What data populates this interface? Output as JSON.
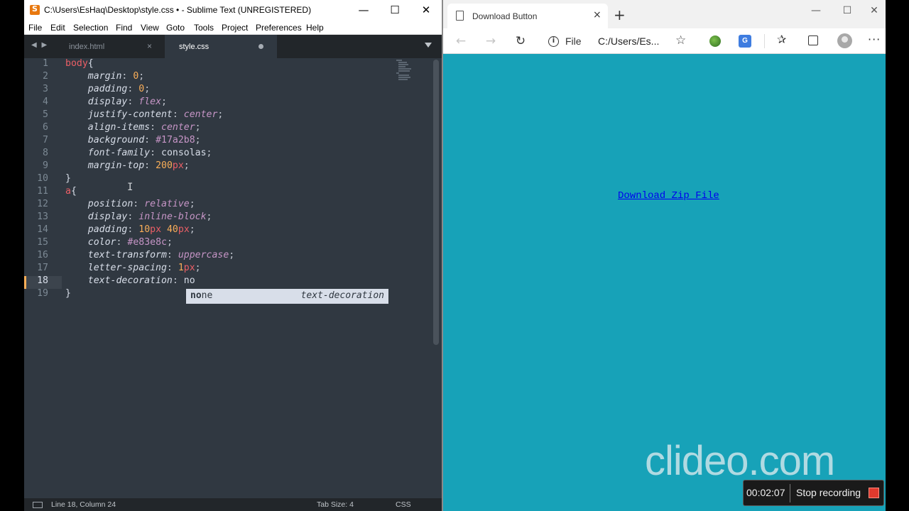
{
  "sublime": {
    "title": "C:\\Users\\EsHaq\\Desktop\\style.css • - Sublime Text (UNREGISTERED)",
    "menu": [
      "File",
      "Edit",
      "Selection",
      "Find",
      "View",
      "Goto",
      "Tools",
      "Project",
      "Preferences",
      "Help"
    ],
    "tab_nav": "◀ ▶",
    "tabs": [
      {
        "label": "index.html",
        "close": "×",
        "active": false
      },
      {
        "label": "style.css",
        "active": true,
        "modified": true
      }
    ],
    "line_numbers": [
      "1",
      "2",
      "3",
      "4",
      "5",
      "6",
      "7",
      "8",
      "9",
      "10",
      "11",
      "12",
      "13",
      "14",
      "15",
      "16",
      "17",
      "18",
      "19"
    ],
    "code": {
      "l1_sel": "body",
      "l1_brace": "{",
      "l2_prop": "margin",
      "l2_num": "0",
      "l3_prop": "padding",
      "l3_num": "0",
      "l4_prop": "display",
      "l4_val": "flex",
      "l5_prop": "justify-content",
      "l5_val": "center",
      "l6_prop": "align-items",
      "l6_val": "center",
      "l7_prop": "background",
      "l7_val": "#17a2b8",
      "l8_prop": "font-family",
      "l8_val": "consolas",
      "l9_prop": "margin-top",
      "l9_num": "200",
      "l9_unit": "px",
      "l10": "}",
      "l11_sel": "a",
      "l11_brace": "{",
      "l12_prop": "position",
      "l12_val": "relative",
      "l13_prop": "display",
      "l13_val": "inline-block",
      "l14_prop": "padding",
      "l14_num1": "10",
      "l14_unit1": "px",
      "l14_num2": "40",
      "l14_unit2": "px",
      "l15_prop": "color",
      "l15_val": "#e83e8c",
      "l16_prop": "text-transform",
      "l16_val": "uppercase",
      "l17_prop": "letter-spacing",
      "l17_num": "1",
      "l17_unit": "px",
      "l18_prop": "text-decoration",
      "l18_val": "no",
      "l19": "}",
      "colon": ":",
      "semi": ";"
    },
    "autocomplete": {
      "match": "no",
      "rest": "ne",
      "hint": "text-decoration"
    },
    "status": {
      "position": "Line 18, Column 24",
      "tab_size": "Tab Size: 4",
      "syntax": "CSS"
    }
  },
  "browser": {
    "tab_title": "Download Button",
    "tab_close": "×",
    "new_tab": "+",
    "address_label": "File",
    "url": "C:/Users/Es...",
    "translate_badge": "G",
    "link_text": "Download Zip File",
    "page_background": "#17a2b8"
  },
  "overlay": {
    "watermark": "clideo.com",
    "rec_time": "00:02:07",
    "rec_stop_label": "Stop recording"
  },
  "icons": {
    "sub_min": "—",
    "sub_max": "☐",
    "sub_close": "✕",
    "br_min": "—",
    "br_max": "☐",
    "br_close": "✕",
    "back": "←",
    "forward": "→",
    "refresh": "↻",
    "info": "i",
    "star": "☆",
    "favorites": "✰",
    "more": "···"
  }
}
